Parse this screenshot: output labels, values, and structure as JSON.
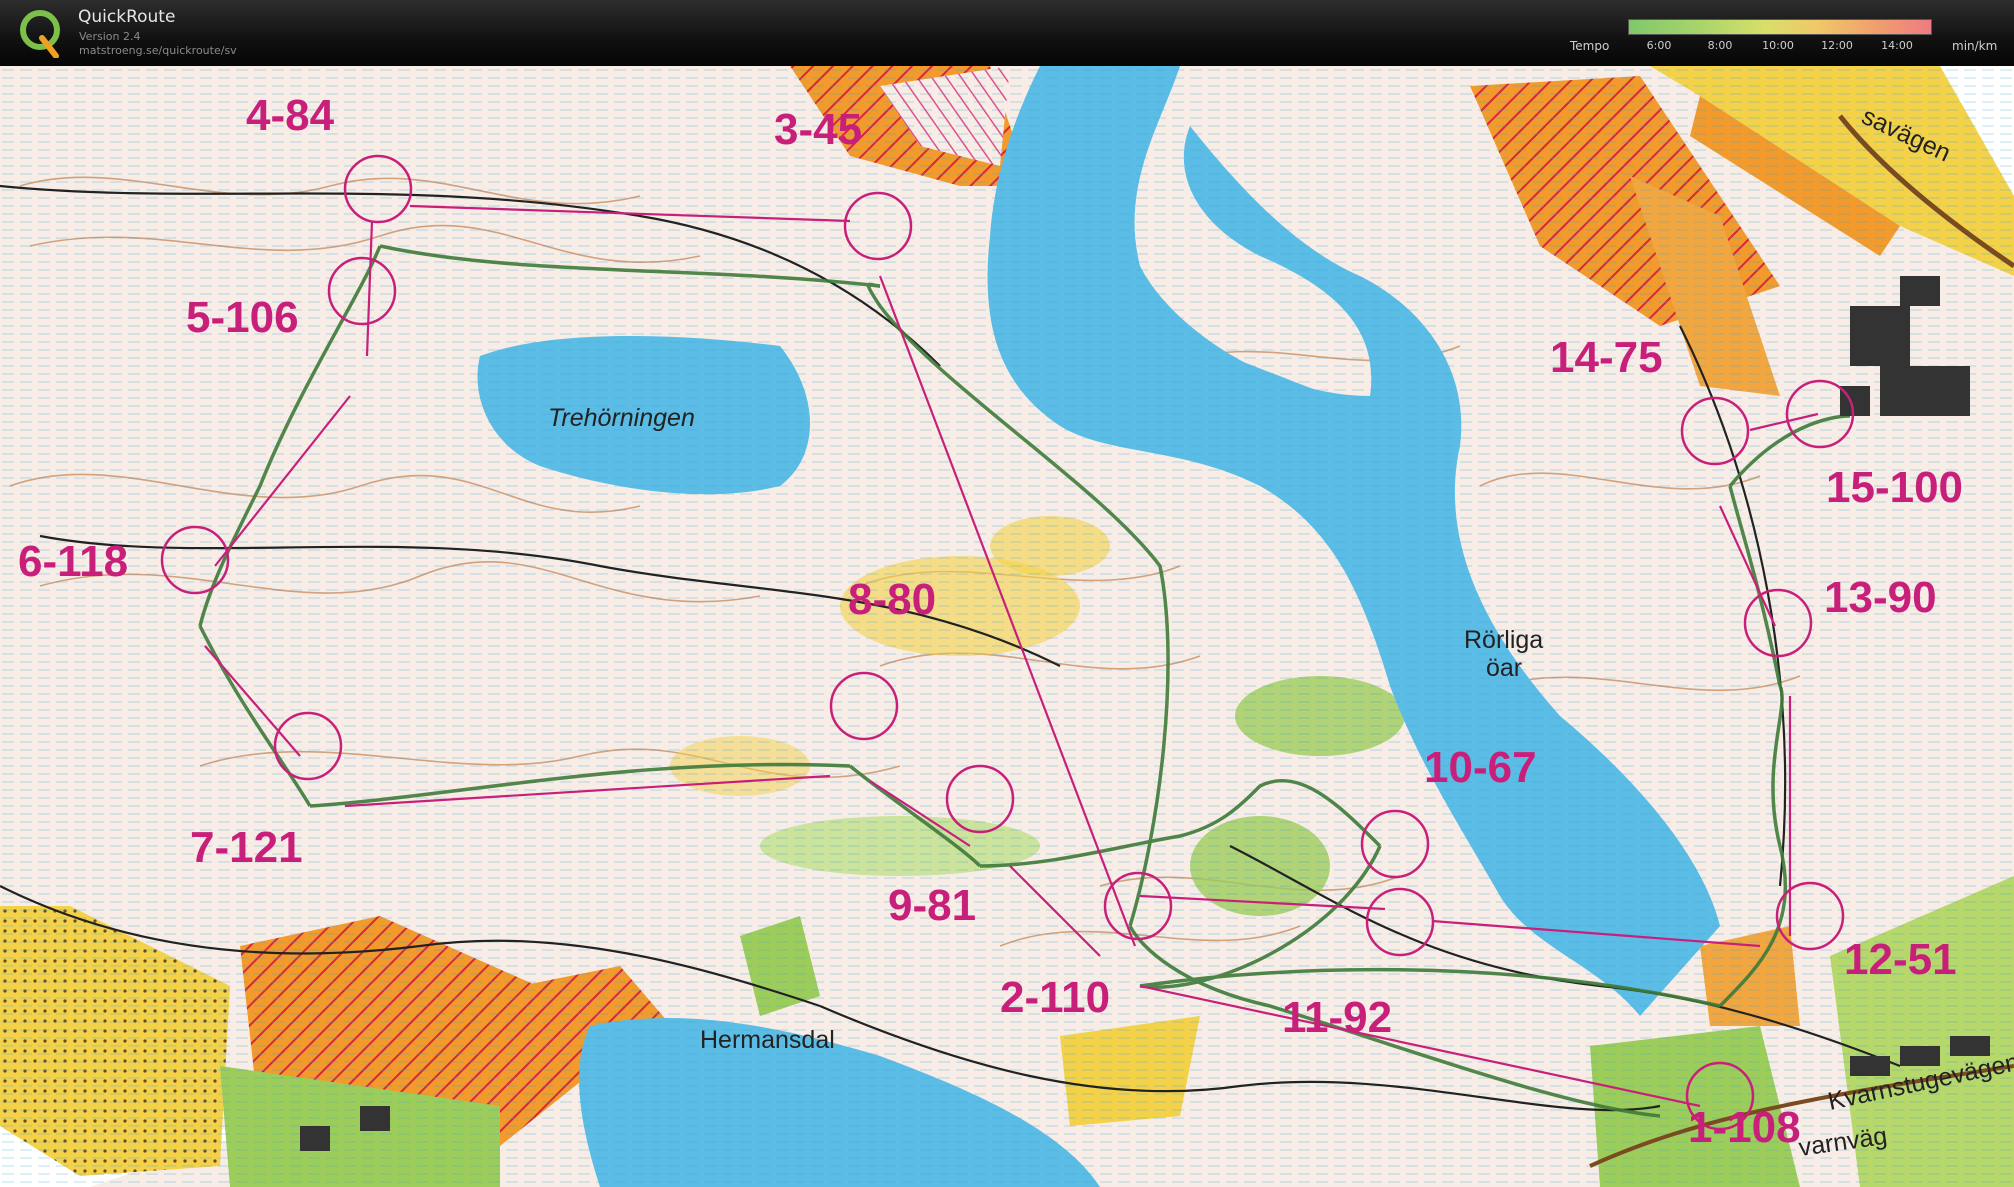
{
  "app": {
    "title": "QuickRoute",
    "version": "Version 2.4",
    "url": "matstroeng.se/quickroute/sv",
    "logo_letter": "Q"
  },
  "tempo_legend": {
    "label": "Tempo",
    "ticks": [
      "6:00",
      "8:00",
      "10:00",
      "12:00",
      "14:00"
    ],
    "unit": "min/km",
    "colors": [
      "#7fc86b",
      "#d8df6a",
      "#f0c86a",
      "#ee7b82"
    ]
  },
  "map": {
    "place_names": {
      "lake_north": "Trehörningen",
      "islands": [
        "Rörliga",
        "öar"
      ],
      "bay_south": "Hermansdal",
      "road_ne": "savägen",
      "road_se": "Kvarnstugevägen",
      "road_se2": "varnväg"
    },
    "controls": [
      {
        "label": "1-108"
      },
      {
        "label": "2-110"
      },
      {
        "label": "3-45"
      },
      {
        "label": "4-84"
      },
      {
        "label": "5-106"
      },
      {
        "label": "6-118"
      },
      {
        "label": "7-121"
      },
      {
        "label": "8-80"
      },
      {
        "label": "9-81"
      },
      {
        "label": "10-67"
      },
      {
        "label": "11-92"
      },
      {
        "label": "12-51"
      },
      {
        "label": "13-90"
      },
      {
        "label": "14-75"
      },
      {
        "label": "15-100"
      }
    ],
    "colors": {
      "course": "#c8207a",
      "water": "#5bbde6",
      "terrain": "#f7ede6",
      "contour": "#b8733a",
      "route": "#3f7a3a",
      "yellow": "#f3d24a",
      "orange": "#f29a2b",
      "green": "#9ccc5a"
    }
  }
}
